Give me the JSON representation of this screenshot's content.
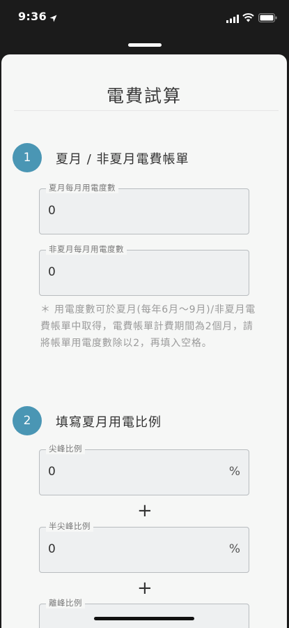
{
  "status_bar": {
    "time": "9:36",
    "icons": [
      "location-arrow-icon",
      "signal-icon",
      "wifi-icon",
      "battery-icon"
    ]
  },
  "sheet": {
    "title": "電費試算"
  },
  "section1": {
    "number": "1",
    "title": "夏月 / 非夏月電費帳單",
    "summer_field": {
      "label": "夏月每月用電度數",
      "value": "0"
    },
    "nonsummer_field": {
      "label": "非夏月每月用電度數",
      "value": "0"
    },
    "note": "＊ 用電度數可於夏月(每年6月～9月)/非夏月電費帳單中取得，電費帳單計費期間為2個月，請將帳單用電度數除以2，再填入空格。"
  },
  "section2": {
    "number": "2",
    "title": "填寫夏月用電比例",
    "peak_field": {
      "label": "尖峰比例",
      "value": "0",
      "unit": "%"
    },
    "semipeak_field": {
      "label": "半尖峰比例",
      "value": "0",
      "unit": "%"
    },
    "offpeak_field": {
      "label": "離峰比例",
      "value": ""
    },
    "plus": "+"
  },
  "colors": {
    "accent": "#4a96b4",
    "sheet_bg": "#f6f7f6",
    "field_bg": "#eef0f1",
    "backdrop": "#1b1b1b"
  }
}
